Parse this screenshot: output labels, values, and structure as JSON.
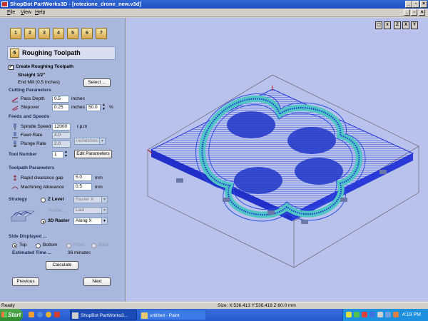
{
  "window": {
    "title": "ShopBot PartWorks3D - [rotezione_drone_new.v3d]"
  },
  "menu": [
    "File",
    "View",
    "Help"
  ],
  "toolbar": {
    "tools": [
      "1",
      "2",
      "3",
      "4",
      "5",
      "6",
      "7"
    ]
  },
  "panel": {
    "header": "Roughing Toolpath",
    "create_label": "Create Roughing Toolpath",
    "create_checked": true,
    "tool_name": "Straight 1/2\"",
    "tool_desc": "End Mill (0.5 inches)",
    "select_button": "Select ...",
    "cutting": {
      "title": "Cutting Parameters",
      "pass_depth_label": "Pass Depth",
      "pass_depth_value": "0.5",
      "pass_depth_unit": "inches",
      "stepover_label": "Stepover",
      "stepover_value": "0.25",
      "stepover_unit": "inches",
      "stepover_pct": "50.0",
      "pct_sign": "%"
    },
    "feeds": {
      "title": "Feeds and Speeds",
      "spindle_label": "Spindle Speed",
      "spindle_value": "12000",
      "spindle_unit": "r.p.m",
      "feed_label": "Feed Rate",
      "feed_value": "4.0",
      "plunge_label": "Plunge Rate",
      "plunge_value": "2.0",
      "rate_unit": "inches/sec"
    },
    "tool_number_label": "Tool Number",
    "tool_number_value": "1",
    "edit_params_button": "Edit Parameters",
    "toolpath": {
      "title": "Toolpath Parameters",
      "rapid_label": "Rapid clearance gap",
      "rapid_value": "5.0",
      "rapid_unit": "mm",
      "allowance_label": "Machining Allowance",
      "allowance_value": "0.5",
      "allowance_unit": "mm"
    },
    "strategy": {
      "label": "Strategy",
      "z_level_label": "Z Level",
      "z_level_option": "Raster X",
      "profile_label": "Profile ...",
      "profile_option": "Last",
      "raster_label": "3D Raster",
      "raster_option": "Along X",
      "selected": "3D Raster"
    },
    "side": {
      "title": "Side Displayed ...",
      "top": "Top",
      "bottom": "Bottom",
      "front": "Front",
      "back": "Back",
      "selected": "Top"
    },
    "estimated_label": "Estimated Time ...",
    "estimated_value": "36 minutes",
    "calculate_button": "Calculate",
    "previous_button": "Previous",
    "next_button": "Next"
  },
  "viewport": {
    "view_buttons": [
      "iso",
      "X",
      "Z",
      "X",
      "Y"
    ],
    "background_color": "#b9c2ed",
    "toolpath_color": "#1e2fd8",
    "model_color": "#4fc6c4"
  },
  "status": {
    "left": "Ready",
    "coords": "Size: X:536.413 Y:536.418 Z:60.0 mm"
  },
  "taskbar": {
    "start": "Start",
    "tasks": [
      "ShopBot PartWorks3...",
      "untitled - Paint"
    ],
    "clock": "4:19 PM"
  }
}
